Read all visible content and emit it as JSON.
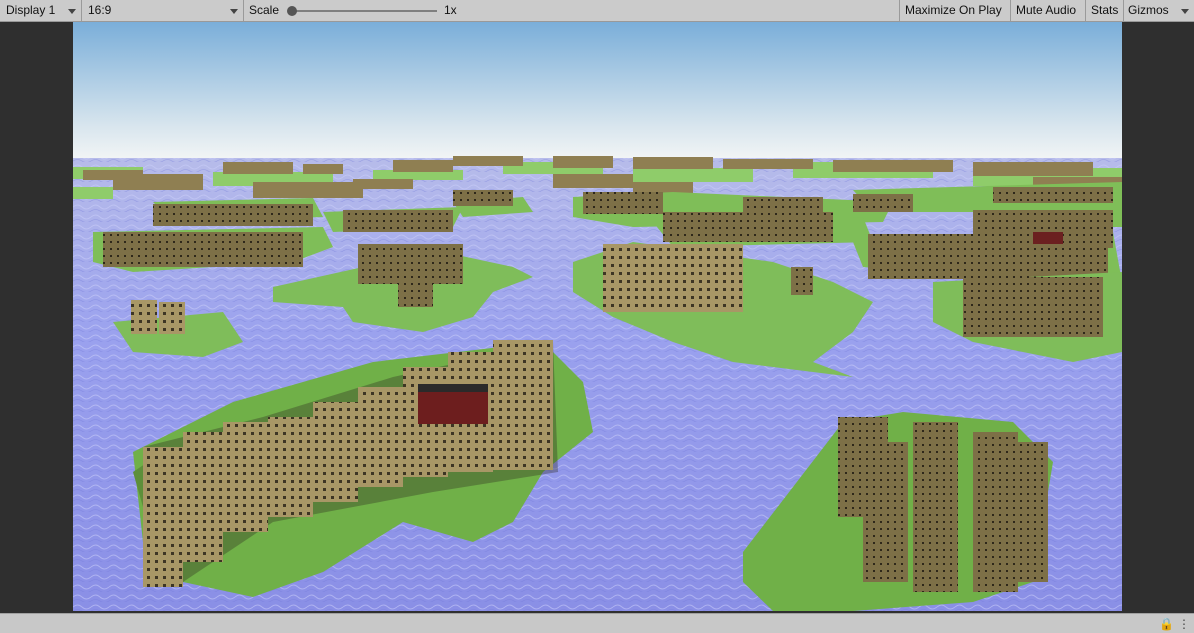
{
  "toolbar": {
    "display": "Display 1",
    "aspect": "16:9",
    "scale_label": "Scale",
    "scale_value": "1x",
    "maximize_on_play": "Maximize On Play",
    "mute_audio": "Mute Audio",
    "stats": "Stats",
    "gizmos": "Gizmos"
  },
  "colors": {
    "sky_top": "#7fb0dc",
    "sky_horizon": "#f2f4f4",
    "water": "#8f98e6",
    "grass": "#7fbd5a",
    "building": "#9b8a5a",
    "building_roof": "#2e2e2e",
    "red_building": "#7a1f1f"
  },
  "icons": {
    "lock": "lock-icon",
    "menu": "kebab-menu-icon",
    "caret": "caret-down-icon"
  }
}
